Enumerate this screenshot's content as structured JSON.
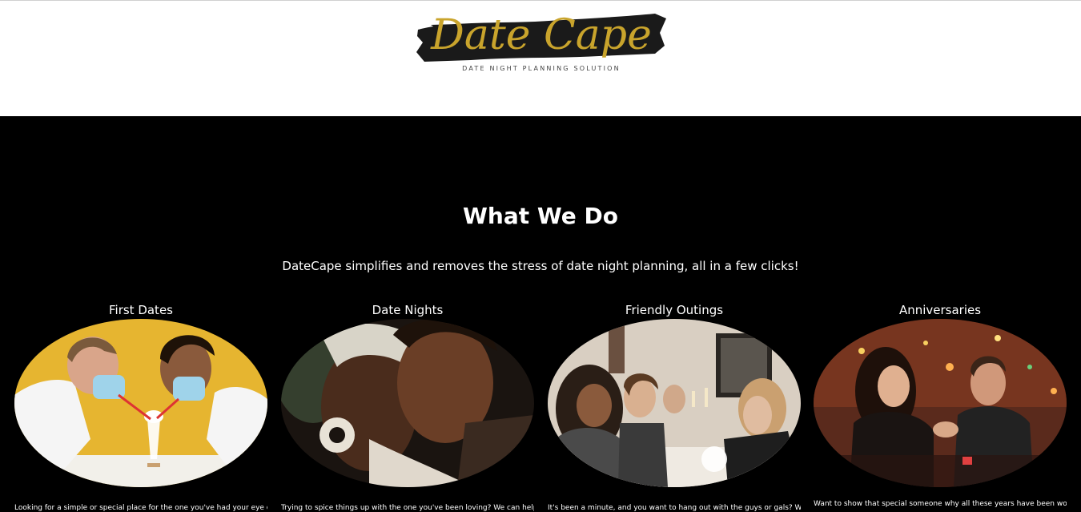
{
  "header": {
    "logo_text": "Date Cape",
    "tagline": "DATE NIGHT PLANNING SOLUTION"
  },
  "section": {
    "title": "What We Do",
    "subtitle": "DateCape simplifies and removes the stress of date night planning, all in a few clicks!"
  },
  "cards": [
    {
      "title": "First Dates",
      "description": "Looking for a simple or special place for the one you've had your eye on?",
      "photo": "couple-sharing-milkshake-photo"
    },
    {
      "title": "Date Nights",
      "description": "Trying to spice things up with the one you've been loving? We can help",
      "photo": "couple-embrace-photo"
    },
    {
      "title": "Friendly Outings",
      "description": "It's been a minute, and you want to hang out with the guys or gals? We",
      "photo": "friends-dinner-photo"
    },
    {
      "title": "Anniversaries",
      "description": "Want to show that special someone why all these years have been worth",
      "photo": "couple-anniversary-dinner-photo"
    }
  ],
  "colors": {
    "gold": "#c9a42c",
    "brush": "#1a1a1a",
    "background": "#000000"
  }
}
